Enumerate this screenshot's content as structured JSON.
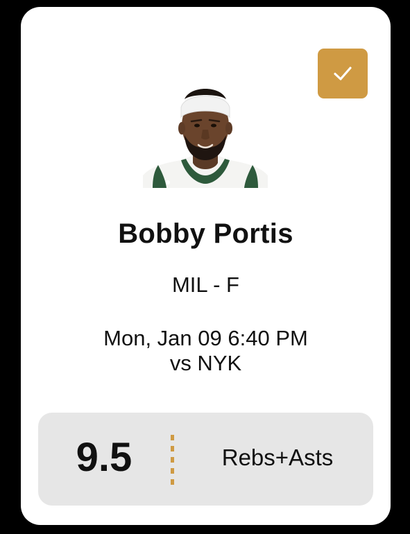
{
  "card": {
    "player_name": "Bobby Portis",
    "team_position": "MIL - F",
    "game_time_line1": "Mon, Jan 09 6:40 PM",
    "game_time_line2": "vs NYK",
    "selected": true
  },
  "stat": {
    "line": "9.5",
    "type": "Rebs+Asts"
  },
  "icons": {
    "toggle": "checkmark-icon",
    "avatar": "player-headshot"
  },
  "colors": {
    "accent": "#cf9a43",
    "background": "#000000",
    "card": "#ffffff",
    "stat_box": "#e6e6e6",
    "jersey": "#2e5a3c"
  }
}
